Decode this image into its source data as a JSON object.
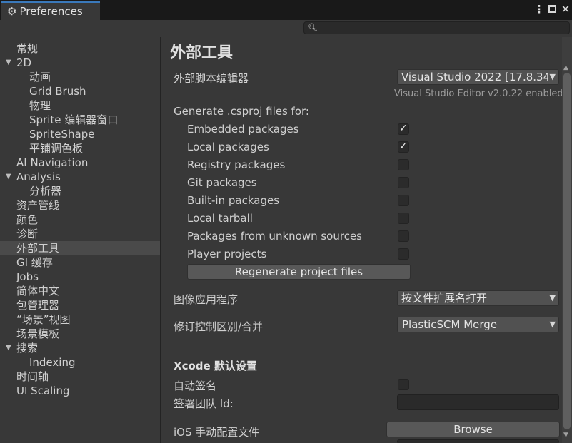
{
  "window": {
    "tab_title": "Preferences",
    "tab_icon": "gear-icon"
  },
  "search": {
    "placeholder": "",
    "icon": "search-icon"
  },
  "sidebar": {
    "items": [
      {
        "label": "常规"
      },
      {
        "label": "2D",
        "expanded": true
      },
      {
        "label": "动画"
      },
      {
        "label": "Grid Brush"
      },
      {
        "label": "物理"
      },
      {
        "label": "Sprite 编辑器窗口"
      },
      {
        "label": "SpriteShape"
      },
      {
        "label": "平铺调色板"
      },
      {
        "label": "AI Navigation"
      },
      {
        "label": "Analysis",
        "expanded": true
      },
      {
        "label": "分析器"
      },
      {
        "label": "资产管线"
      },
      {
        "label": "颜色"
      },
      {
        "label": "诊断"
      },
      {
        "label": "外部工具",
        "selected": true
      },
      {
        "label": "GI 缓存"
      },
      {
        "label": "Jobs"
      },
      {
        "label": "简体中文"
      },
      {
        "label": "包管理器"
      },
      {
        "label": "“场景”视图"
      },
      {
        "label": "场景模板"
      },
      {
        "label": "搜索",
        "expanded": true
      },
      {
        "label": "Indexing"
      },
      {
        "label": "时间轴"
      },
      {
        "label": "UI Scaling"
      }
    ]
  },
  "main": {
    "title": "外部工具",
    "script_editor": {
      "label": "外部脚本编辑器",
      "value": "Visual Studio 2022 [17.8.34",
      "version_note": "Visual Studio Editor v2.0.22 enabled"
    },
    "generate_label": "Generate .csproj files for:",
    "packages": [
      {
        "label": "Embedded packages",
        "checked": true
      },
      {
        "label": "Local packages",
        "checked": true
      },
      {
        "label": "Registry packages",
        "checked": false
      },
      {
        "label": "Git packages",
        "checked": false
      },
      {
        "label": "Built-in packages",
        "checked": false
      },
      {
        "label": "Local tarball",
        "checked": false
      },
      {
        "label": "Packages from unknown sources",
        "checked": false
      },
      {
        "label": "Player projects",
        "checked": false
      }
    ],
    "regenerate_button": "Regenerate project files",
    "image_app": {
      "label": "图像应用程序",
      "value": "按文件扩展名打开"
    },
    "revision_control": {
      "label": "修订控制区别/合并",
      "value": "PlasticSCM Merge"
    },
    "xcode": {
      "heading": "Xcode 默认设置",
      "auto_sign_label": "自动签名",
      "auto_sign_checked": false,
      "team_id_label": "签署团队 Id:",
      "team_id_value": "",
      "ios_profile_label": "iOS 手动配置文件",
      "browse_button": "Browse"
    }
  }
}
